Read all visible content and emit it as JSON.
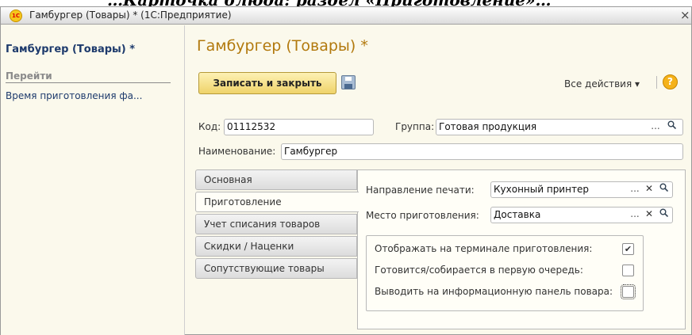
{
  "page_overlay_caption": "…Карточка блюда: раздел «Приготовление»…",
  "window": {
    "title": "Гамбургер (Товары) * (1С:Предприятие)",
    "logo_text": "1С",
    "close_glyph": "×"
  },
  "sidebar": {
    "title": "Гамбургер (Товары) *",
    "section_label": "Перейти",
    "links": [
      "Время приготовления фа..."
    ]
  },
  "header": {
    "page_title": "Гамбургер (Товары) *",
    "save_close_label": "Записать и закрыть",
    "all_actions_label": "Все действия ▾",
    "help_glyph": "?"
  },
  "form": {
    "code_label": "Код:",
    "code_value": "01112532",
    "group_label": "Группа:",
    "group_value": "Готовая продукция",
    "name_label": "Наименование:",
    "name_value": "Гамбургер"
  },
  "tabs": [
    {
      "label": "Основная",
      "active": false
    },
    {
      "label": "Приготовление",
      "active": true
    },
    {
      "label": "Учет списания товаров",
      "active": false
    },
    {
      "label": "Скидки / Наценки",
      "active": false
    },
    {
      "label": "Сопутствующие товары",
      "active": false
    }
  ],
  "prep": {
    "print_direction_label": "Направление печати:",
    "print_direction_value": "Кухонный принтер",
    "prep_place_label": "Место приготовления:",
    "prep_place_value": "Доставка",
    "checkboxes": [
      {
        "label": "Отображать на терминале приготовления:",
        "checked": true,
        "mark": "✔"
      },
      {
        "label": "Готовится/собирается в первую очередь:",
        "checked": false,
        "mark": ""
      },
      {
        "label": "Выводить на информационную панель повара:",
        "checked": false,
        "mark": ""
      }
    ]
  },
  "glyphs": {
    "dots": "...",
    "clear": "✕",
    "search": "🔍"
  },
  "colors": {
    "title_orange": "#b2790d",
    "link_blue": "#1d3a6c",
    "button_yellow": "#efd36a",
    "background": "#fbf9ec"
  }
}
